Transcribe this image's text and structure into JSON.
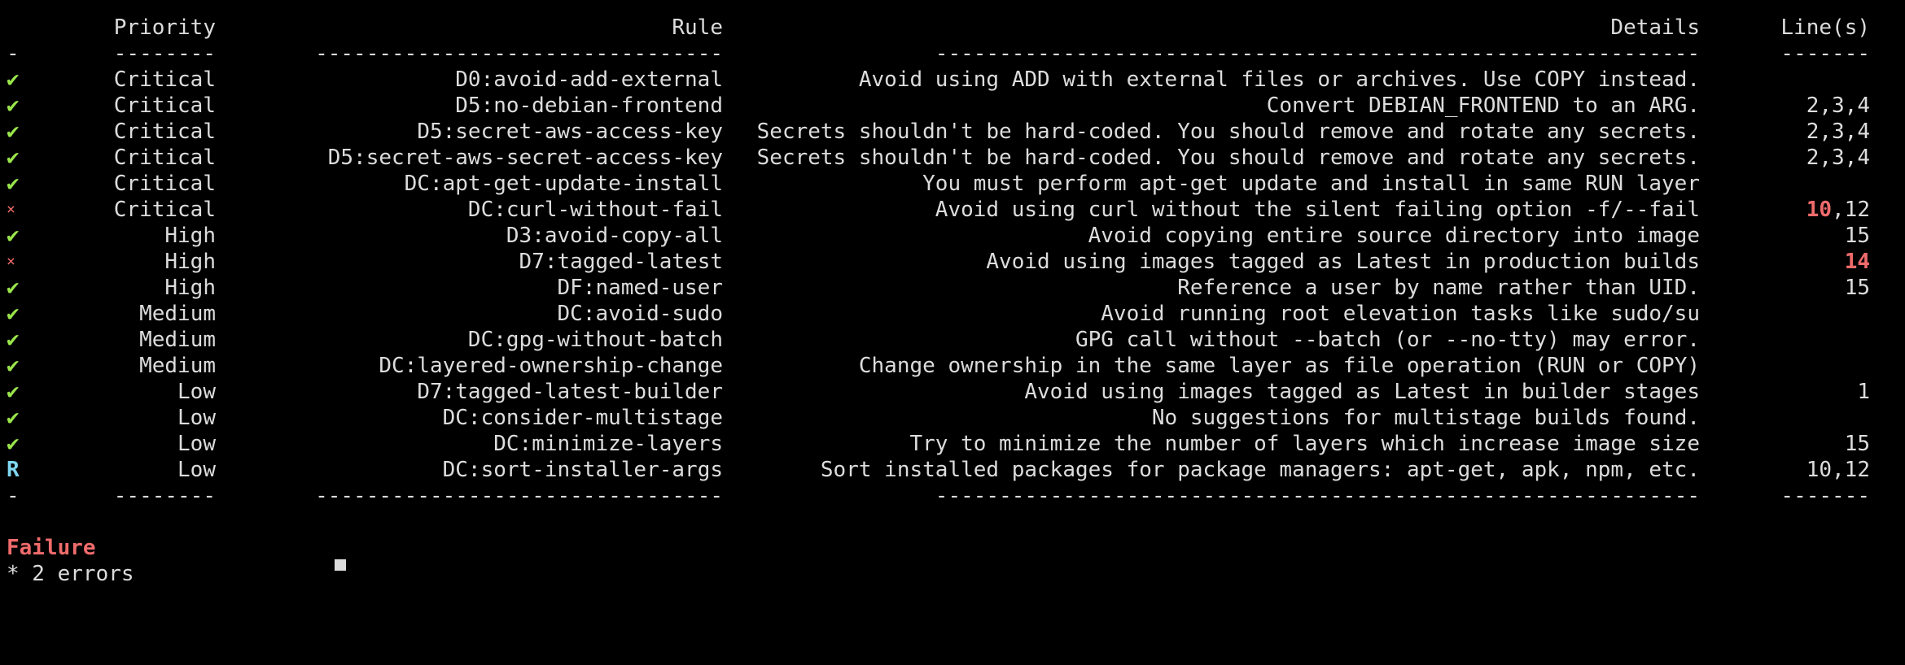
{
  "header": {
    "priority": "Priority",
    "rule": "Rule",
    "details": "Details",
    "lines": "Line(s)"
  },
  "separator": {
    "status": "-",
    "priority": "--------",
    "rule": "--------------------------------",
    "details": "------------------------------------------------------------",
    "lines": "-------"
  },
  "rows": [
    {
      "status": "ok",
      "icon": "✔",
      "priority": "Critical",
      "rule": "D0:avoid-add-external",
      "details": "Avoid using ADD with external files or archives. Use COPY instead.",
      "lines": [
        {
          "text": ""
        }
      ]
    },
    {
      "status": "ok",
      "icon": "✔",
      "priority": "Critical",
      "rule": "D5:no-debian-frontend",
      "details": "Convert DEBIAN_FRONTEND to an ARG.",
      "lines": [
        {
          "text": "2,3,4"
        }
      ]
    },
    {
      "status": "ok",
      "icon": "✔",
      "priority": "Critical",
      "rule": "D5:secret-aws-access-key",
      "details": "Secrets shouldn't be hard-coded. You should remove and rotate any secrets.",
      "lines": [
        {
          "text": "2,3,4"
        }
      ]
    },
    {
      "status": "ok",
      "icon": "✔",
      "priority": "Critical",
      "rule": "D5:secret-aws-secret-access-key",
      "details": "Secrets shouldn't be hard-coded. You should remove and rotate any secrets.",
      "lines": [
        {
          "text": "2,3,4"
        }
      ]
    },
    {
      "status": "ok",
      "icon": "✔",
      "priority": "Critical",
      "rule": "DC:apt-get-update-install",
      "details": "You must perform apt-get update and install in same RUN layer",
      "lines": [
        {
          "text": ""
        }
      ]
    },
    {
      "status": "fail",
      "icon": "×",
      "priority": "Critical",
      "rule": "DC:curl-without-fail",
      "details": "Avoid using curl without the silent failing option -f/--fail",
      "lines": [
        {
          "text": "10",
          "error": true
        },
        {
          "text": ",12"
        }
      ]
    },
    {
      "status": "ok",
      "icon": "✔",
      "priority": "High",
      "rule": "D3:avoid-copy-all",
      "details": "Avoid copying entire source directory into image",
      "lines": [
        {
          "text": "15"
        }
      ]
    },
    {
      "status": "fail",
      "icon": "×",
      "priority": "High",
      "rule": "D7:tagged-latest",
      "details": "Avoid using images tagged as Latest in production builds",
      "lines": [
        {
          "text": "14",
          "error": true
        }
      ]
    },
    {
      "status": "ok",
      "icon": "✔",
      "priority": "High",
      "rule": "DF:named-user",
      "details": "Reference a user by name rather than UID.",
      "lines": [
        {
          "text": "15"
        }
      ]
    },
    {
      "status": "ok",
      "icon": "✔",
      "priority": "Medium",
      "rule": "DC:avoid-sudo",
      "details": "Avoid running root elevation tasks like sudo/su",
      "lines": [
        {
          "text": ""
        }
      ]
    },
    {
      "status": "ok",
      "icon": "✔",
      "priority": "Medium",
      "rule": "DC:gpg-without-batch",
      "details": "GPG call without --batch (or --no-tty) may error.",
      "lines": [
        {
          "text": ""
        }
      ]
    },
    {
      "status": "ok",
      "icon": "✔",
      "priority": "Medium",
      "rule": "DC:layered-ownership-change",
      "details": "Change ownership in the same layer as file operation (RUN or COPY)",
      "lines": [
        {
          "text": ""
        }
      ]
    },
    {
      "status": "ok",
      "icon": "✔",
      "priority": "Low",
      "rule": "D7:tagged-latest-builder",
      "details": "Avoid using images tagged as Latest in builder stages",
      "lines": [
        {
          "text": "1"
        }
      ]
    },
    {
      "status": "ok",
      "icon": "✔",
      "priority": "Low",
      "rule": "DC:consider-multistage",
      "details": "No suggestions for multistage builds found.",
      "lines": [
        {
          "text": ""
        }
      ]
    },
    {
      "status": "ok",
      "icon": "✔",
      "priority": "Low",
      "rule": "DC:minimize-layers",
      "details": "Try to minimize the number of layers which increase image size",
      "lines": [
        {
          "text": "15"
        }
      ]
    },
    {
      "status": "recommend",
      "icon": "R",
      "priority": "Low",
      "rule": "DC:sort-installer-args",
      "details": "Sort installed packages for package managers: apt-get, apk, npm, etc.",
      "lines": [
        {
          "text": "10,12"
        }
      ]
    }
  ],
  "summary": {
    "result": "Failure",
    "errors": "* 2 errors"
  },
  "colors": {
    "background": "#000000",
    "text": "#dcdcdc",
    "ok": "#9ae64a",
    "fail": "#f06b6b",
    "recommend": "#7fd6ef"
  }
}
